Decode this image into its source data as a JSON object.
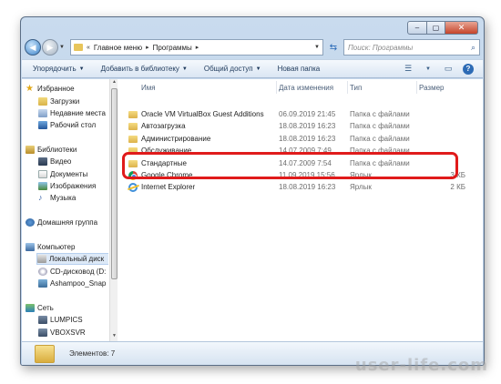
{
  "window": {
    "controls": {
      "minimize": "–",
      "maximize": "▢",
      "close": "✕"
    }
  },
  "address_bar": {
    "back_icon": "back-arrow-icon",
    "forward_icon": "forward-arrow-icon",
    "chevron": "«",
    "crumb_1": "Главное меню",
    "crumb_2": "Программы",
    "sep": "▸",
    "dropdown": "▼",
    "refresh_icon": "refresh-icon"
  },
  "search": {
    "placeholder": "Поиск: Программы"
  },
  "toolbar": {
    "organize": "Упорядочить",
    "add_to_library": "Добавить в библиотеку",
    "share": "Общий доступ",
    "new_folder": "Новая папка",
    "caret": "▼"
  },
  "nav": {
    "favorites": "Избранное",
    "downloads": "Загрузки",
    "recent": "Недавние места",
    "desktop": "Рабочий стол",
    "libraries": "Библиотеки",
    "video": "Видео",
    "documents": "Документы",
    "images": "Изображения",
    "music": "Музыка",
    "homegroup": "Домашняя группа",
    "computer": "Компьютер",
    "local_disk": "Локальный диск",
    "cd_drive": "CD-дисковод (D:",
    "ashampoo": "Ashampoo_Snap",
    "network": "Сеть",
    "lumpics": "LUMPICS",
    "vboxsvr": "VBOXSVR"
  },
  "columns": {
    "name": "Имя",
    "date": "Дата изменения",
    "type": "Тип",
    "size": "Размер"
  },
  "files": [
    {
      "name": "Oracle VM VirtualBox Guest Additions",
      "date": "06.09.2019 21:45",
      "type": "Папка с файлами",
      "size": "",
      "icon": "folder-icon"
    },
    {
      "name": "Автозагрузка",
      "date": "18.08.2019 16:23",
      "type": "Папка с файлами",
      "size": "",
      "icon": "folder-icon"
    },
    {
      "name": "Администрирование",
      "date": "18.08.2019 16:23",
      "type": "Папка с файлами",
      "size": "",
      "icon": "folder-icon"
    },
    {
      "name": "Обслуживание",
      "date": "14.07.2009 7:49",
      "type": "Папка с файлами",
      "size": "",
      "icon": "folder-icon"
    },
    {
      "name": "Стандартные",
      "date": "14.07.2009 7:54",
      "type": "Папка с файлами",
      "size": "",
      "icon": "folder-icon"
    },
    {
      "name": "Google Chrome",
      "date": "11.09.2019 15:56",
      "type": "Ярлык",
      "size": "3 КБ",
      "icon": "chrome-icon"
    },
    {
      "name": "Internet Explorer",
      "date": "18.08.2019 16:23",
      "type": "Ярлык",
      "size": "2 КБ",
      "icon": "internet-explorer-icon"
    }
  ],
  "status": {
    "items_count": "Элементов: 7"
  },
  "watermark": "user-life.com",
  "colors": {
    "highlight": "#e01b1b",
    "window_frame": "#b8cde6"
  }
}
